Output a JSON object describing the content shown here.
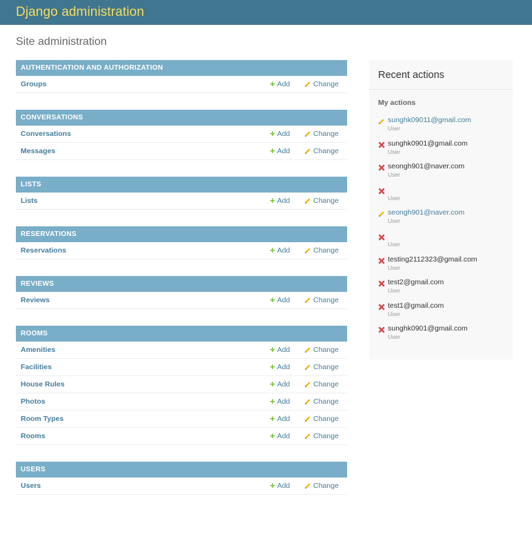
{
  "header": {
    "title": "Django administration"
  },
  "page": {
    "title": "Site administration"
  },
  "modules": [
    {
      "caption": "Authentication and Authorization",
      "models": [
        {
          "name": "Groups"
        }
      ]
    },
    {
      "caption": "Conversations",
      "models": [
        {
          "name": "Conversations"
        },
        {
          "name": "Messages"
        }
      ]
    },
    {
      "caption": "Lists",
      "models": [
        {
          "name": "Lists"
        }
      ]
    },
    {
      "caption": "Reservations",
      "models": [
        {
          "name": "Reservations"
        }
      ]
    },
    {
      "caption": "Reviews",
      "models": [
        {
          "name": "Reviews"
        }
      ]
    },
    {
      "caption": "Rooms",
      "models": [
        {
          "name": "Amenities"
        },
        {
          "name": "Facilities"
        },
        {
          "name": "House Rules"
        },
        {
          "name": "Photos"
        },
        {
          "name": "Room Types"
        },
        {
          "name": "Rooms"
        }
      ]
    },
    {
      "caption": "Users",
      "models": [
        {
          "name": "Users"
        }
      ]
    }
  ],
  "links": {
    "add": "Add",
    "change": "Change"
  },
  "recent": {
    "title": "Recent actions",
    "subtitle": "My actions",
    "actions": [
      {
        "icon": "edit",
        "title": "sunghk09011@gmail.com",
        "type": "User",
        "linked": true
      },
      {
        "icon": "delete",
        "title": "sunghk0901@gmail.com",
        "type": "User",
        "linked": false
      },
      {
        "icon": "delete",
        "title": "seongh901@naver.com",
        "type": "User",
        "linked": false
      },
      {
        "icon": "delete",
        "title": "",
        "type": "User",
        "linked": false
      },
      {
        "icon": "edit",
        "title": "seongh901@naver.com",
        "type": "User",
        "linked": true
      },
      {
        "icon": "delete",
        "title": "",
        "type": "User",
        "linked": false
      },
      {
        "icon": "delete",
        "title": "testing2112323@gmail.com",
        "type": "User",
        "linked": false
      },
      {
        "icon": "delete",
        "title": "test2@gmail.com",
        "type": "User",
        "linked": false
      },
      {
        "icon": "delete",
        "title": "test1@gmail.com",
        "type": "User",
        "linked": false
      },
      {
        "icon": "delete",
        "title": "sunghk0901@gmail.com",
        "type": "User",
        "linked": false
      }
    ]
  },
  "colors": {
    "header_bg": "#417690",
    "header_text": "#f5dd5d",
    "caption_bg": "#79aec8",
    "link": "#447e9b",
    "add_green": "#70bf2b",
    "delete_red": "#dd4646",
    "edit_yellow": "#efb80b"
  }
}
